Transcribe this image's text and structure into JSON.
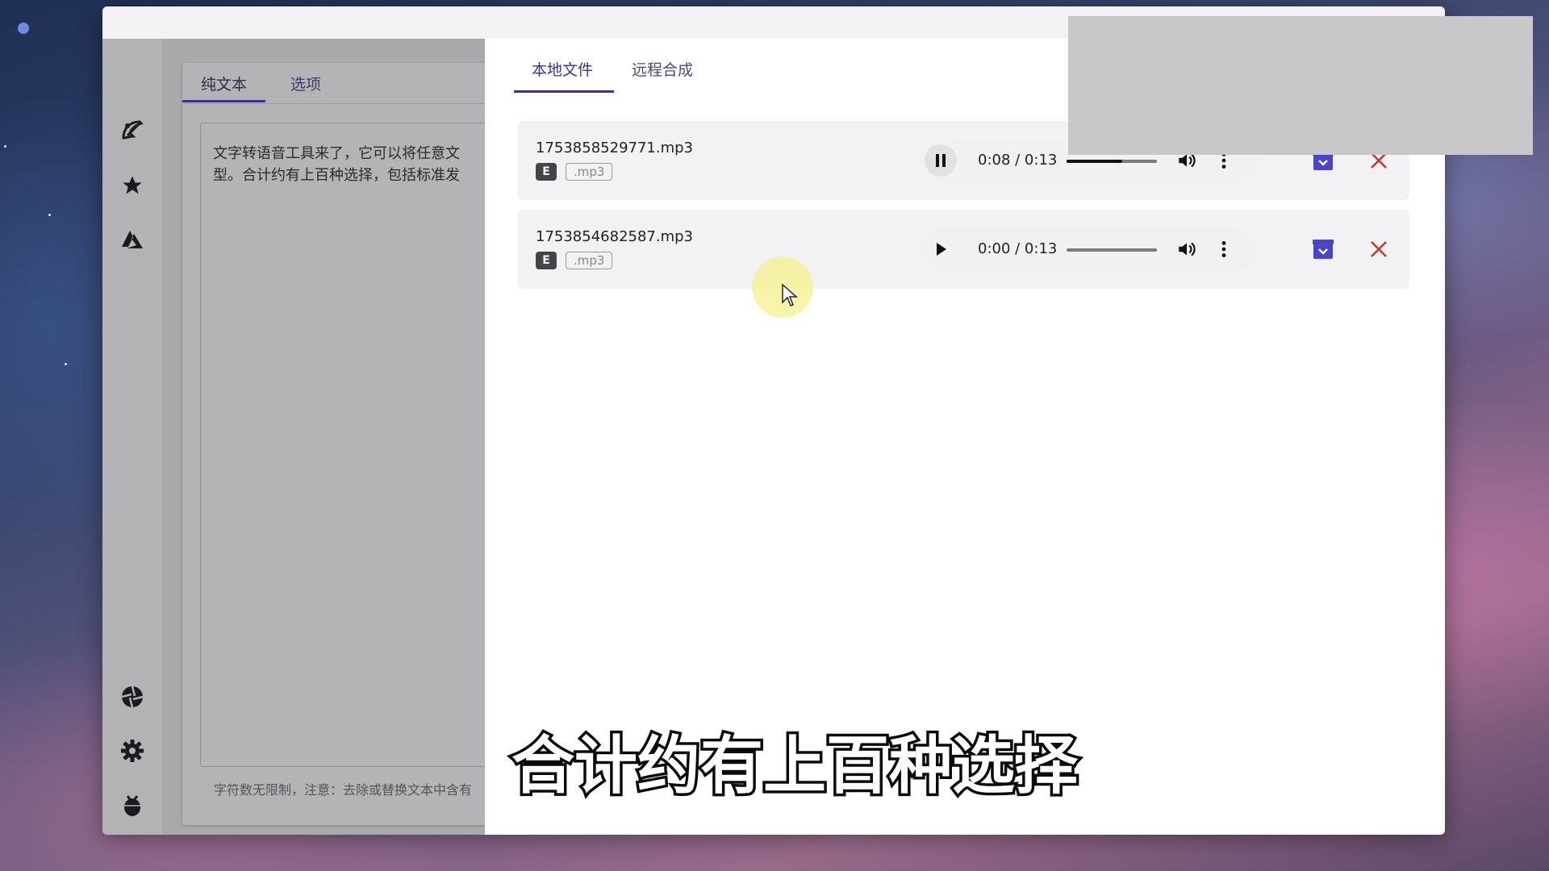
{
  "editor": {
    "tabs": [
      {
        "label": "纯文本",
        "active": true
      },
      {
        "label": "选项",
        "active": false
      }
    ],
    "text_line1": "文字转语音工具来了，它可以将任意文",
    "text_line2": "型。合计约有上百种选择，包括标准发",
    "hint": "字符数无限制，注意：去除或替换文本中含有"
  },
  "panel": {
    "tabs": [
      {
        "label": "本地文件",
        "active": true
      },
      {
        "label": "远程合成",
        "active": false
      }
    ],
    "items": [
      {
        "filename": "1753858529771.mp3",
        "badge": "E",
        "ext": ".mp3",
        "time": "0:08 / 0:13",
        "playing": true,
        "progress": 0.62
      },
      {
        "filename": "1753854682587.mp3",
        "badge": "E",
        "ext": ".mp3",
        "time": "0:00 / 0:13",
        "playing": false,
        "progress": 0
      }
    ]
  },
  "icons": {
    "sidebar_top": [
      "palette-icon",
      "star-icon",
      "azure-icon"
    ],
    "sidebar_bottom": [
      "aperture-icon",
      "gear-icon",
      "bug-icon"
    ]
  },
  "colors": {
    "accent": "#3b338a",
    "save": "#4b43c8",
    "close": "#c0392b"
  },
  "subtitle": "合计约有上百种选择"
}
